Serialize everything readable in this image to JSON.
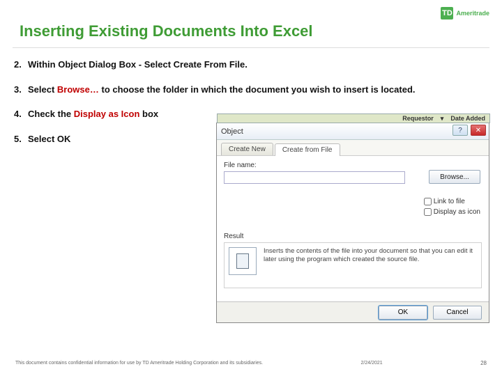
{
  "brand": {
    "logo": "TD",
    "name": "Ameritrade"
  },
  "title": "Inserting Existing Documents Into Excel",
  "steps": [
    {
      "n": "2.",
      "parts": [
        {
          "t": "Within Object Dialog Box - Select Create From File.",
          "hl": false
        }
      ]
    },
    {
      "n": "3.",
      "parts": [
        {
          "t": "Select ",
          "hl": false
        },
        {
          "t": "Browse…",
          "hl": true
        },
        {
          "t": " to choose the folder in which the document you wish to insert is located.",
          "hl": false
        }
      ]
    },
    {
      "n": "4.",
      "parts": [
        {
          "t": "Check the ",
          "hl": false
        },
        {
          "t": "Display as Icon",
          "hl": true
        },
        {
          "t": " box",
          "hl": false
        }
      ]
    },
    {
      "n": "5.",
      "parts": [
        {
          "t": "Select OK",
          "hl": false
        }
      ]
    }
  ],
  "ribbon": {
    "requestor": "Requestor",
    "date_added": "Date Added"
  },
  "dialog": {
    "title": "Object",
    "help": "?",
    "close": "✕",
    "tabs": {
      "create_new": "Create New",
      "create_from_file": "Create from File"
    },
    "file_label": "File name:",
    "file_value": "",
    "browse": "Browse...",
    "link_to_file": "Link to file",
    "display_as_icon": "Display as icon",
    "result_label": "Result",
    "result_text": "Inserts the contents of the file into your document so that you can edit it later using the program which created the source file.",
    "ok": "OK",
    "cancel": "Cancel"
  },
  "footer": {
    "confidential": "This document contains confidential information for use by TD Ameritrade Holding Corporation and its subsidiaries.",
    "date": "2/24/2021",
    "page": "28"
  }
}
